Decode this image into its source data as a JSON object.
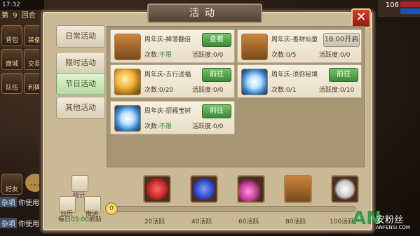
{
  "hud": {
    "time": "17:32",
    "round_label": "第",
    "round_num": "9",
    "round_suffix": "回合",
    "top_right_num": "106",
    "buttons": [
      "背包",
      "装备",
      "商城",
      "交易",
      "队伍",
      "利碑"
    ],
    "friend": "好友",
    "chat_lines": [
      {
        "tag": "杂项",
        "text": "你使用"
      },
      {
        "tag": "杂项",
        "text": "你使用"
      }
    ]
  },
  "panel": {
    "title": "活动",
    "close_label": "✕",
    "tabs": [
      {
        "label": "日常活动",
        "active": false
      },
      {
        "label": "限时活动",
        "active": false
      },
      {
        "label": "节日活动",
        "active": true
      },
      {
        "label": "其他活动",
        "active": false
      }
    ],
    "cards": [
      {
        "name": "周年庆-掉落翻倍",
        "count_label": "次数:",
        "count_value": "不限",
        "activity": "活跃度:0/0",
        "button": "查看",
        "button_style": "green",
        "icon": "chest-icon"
      },
      {
        "name": "周年庆-善财仙童",
        "count_label": "次数:",
        "count_value": "0/5",
        "activity": "活跃度:0/0",
        "button": "18:00开启",
        "button_style": "gray",
        "icon": "chest-icon"
      },
      {
        "name": "周年庆-五行送福",
        "count_label": "次数:",
        "count_value": "0/20",
        "activity": "活跃度:0/0",
        "button": "前往",
        "button_style": "green",
        "icon": "flame-icon"
      },
      {
        "name": "周年庆-须弥秘境",
        "count_label": "次数:",
        "count_value": "0/1",
        "activity": "活跃度:0/10",
        "button": "前往",
        "button_style": "green",
        "icon": "exp-icon"
      },
      {
        "name": "周年庆-招福宝树",
        "count_label": "次数:",
        "count_value": "不限",
        "activity": "活跃度:0/0",
        "button": "前往",
        "button_style": "green",
        "icon": "exp-icon"
      }
    ],
    "bottom": {
      "stats_label": "统计",
      "calendar_label": "日历",
      "mail_label": "推送",
      "daily_prefix": "每日",
      "daily_time": "05:00",
      "daily_suffix": "刷新",
      "current_activity": "0",
      "milestones": [
        {
          "label": "20活跃",
          "icon": "red-orb-icon"
        },
        {
          "label": "40活跃",
          "icon": "blue-orb-icon"
        },
        {
          "label": "60活跃",
          "icon": "pink-gems-icon"
        },
        {
          "label": "80活跃",
          "icon": "chest-icon"
        },
        {
          "label": "100活跃",
          "icon": "silver-ingot-icon"
        }
      ]
    }
  },
  "watermark": {
    "logo": "AN",
    "text": "安粉丝",
    "url": "ANFENSI.COM"
  }
}
